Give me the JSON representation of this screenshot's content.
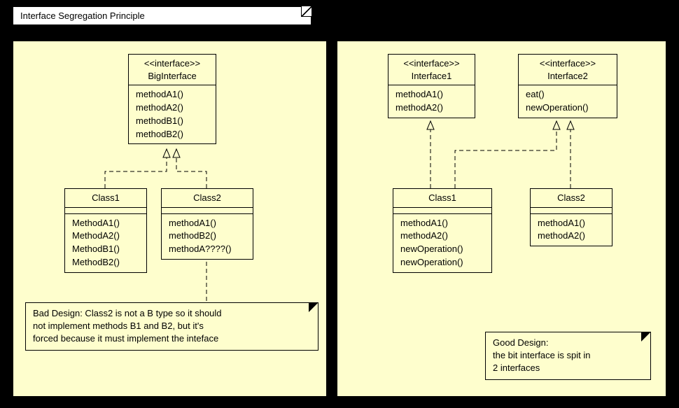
{
  "title": "Interface Segregation Principle",
  "left": {
    "interface": {
      "stereotype": "<<interface>>",
      "name": "BigInterface",
      "methods": [
        "methodA1()",
        "methodA2()",
        "methodB1()",
        "methodB2()"
      ]
    },
    "class1": {
      "name": "Class1",
      "methods": [
        "MethodA1()",
        "MethodA2()",
        "MethodB1()",
        "MethodB2()"
      ]
    },
    "class2": {
      "name": "Class2",
      "methods": [
        "methodA1()",
        "methodB2()",
        "methodA????()"
      ]
    },
    "note": {
      "line1": "Bad Design: Class2 is not a B type so it should",
      "line2": "not implement methods B1 and B2, but it's",
      "line3": "forced because it must implement the inteface"
    }
  },
  "right": {
    "interface1": {
      "stereotype": "<<interface>>",
      "name": "Interface1",
      "methods": [
        "methodA1()",
        "methodA2()"
      ]
    },
    "interface2": {
      "stereotype": "<<interface>>",
      "name": "Interface2",
      "methods": [
        "eat()",
        "newOperation()"
      ]
    },
    "class1": {
      "name": "Class1",
      "methods": [
        "methodA1()",
        "methodA2()",
        "newOperation()",
        "newOperation()"
      ]
    },
    "class2": {
      "name": "Class2",
      "methods": [
        "methodA1()",
        "methodA2()"
      ]
    },
    "note": {
      "line1": "Good Design:",
      "line2": "the bit interface is spit in",
      "line3": "2 interfaces"
    }
  }
}
